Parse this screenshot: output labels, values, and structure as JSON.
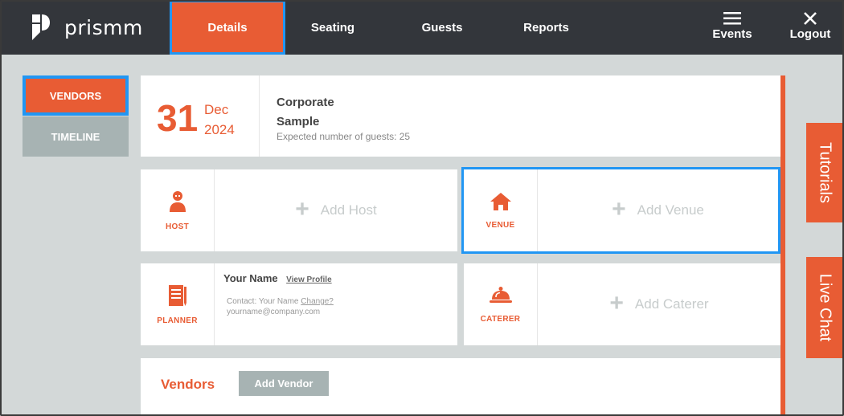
{
  "app": {
    "logo_text": "prismm"
  },
  "nav": {
    "tabs": [
      {
        "label": "Details"
      },
      {
        "label": "Seating"
      },
      {
        "label": "Guests"
      },
      {
        "label": "Reports"
      }
    ],
    "events_label": "Events",
    "logout_label": "Logout"
  },
  "sidebar": {
    "vendors_label": "VENDORS",
    "timeline_label": "TIMELINE"
  },
  "event": {
    "day": "31",
    "month": "Dec",
    "year": "2024",
    "title_line1": "Corporate",
    "title_line2": "Sample",
    "guests_text": "Expected number of guests: 25"
  },
  "tiles": {
    "host": {
      "label": "HOST",
      "add_label": "Add Host"
    },
    "venue": {
      "label": "VENUE",
      "add_label": "Add Venue"
    },
    "planner": {
      "label": "PLANNER",
      "name": "Your Name",
      "view_profile": "View Profile",
      "contact_prefix": "Contact: Your Name",
      "change_link": "Change?",
      "email": "yourname@company.com"
    },
    "caterer": {
      "label": "CATERER",
      "add_label": "Add Caterer"
    }
  },
  "vendors": {
    "title": "Vendors",
    "add_button": "Add Vendor"
  },
  "side_tabs": {
    "tutorials": "Tutorials",
    "live_chat": "Live Chat"
  },
  "colors": {
    "accent": "#e85c34",
    "topbar": "#33363b",
    "highlight": "#2196f3",
    "gray_button": "#a7b3b3"
  }
}
